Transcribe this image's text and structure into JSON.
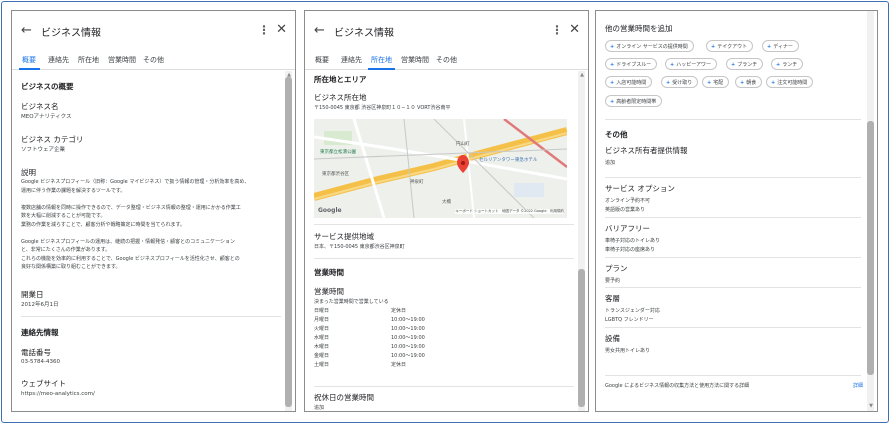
{
  "header": {
    "title": "ビジネス情報",
    "back_icon": "arrow-back-icon",
    "more_icon": "more-vert-icon",
    "close_icon": "close-icon"
  },
  "tabs": [
    "概要",
    "連絡先",
    "所在地",
    "営業時間",
    "その他"
  ],
  "panel1": {
    "overview_title": "ビジネスの概要",
    "name_label": "ビジネス名",
    "name_value": "MEOアナリティクス",
    "category_label": "ビジネス カテゴリ",
    "category_value": "ソフトウェア企業",
    "desc_label": "説明",
    "desc_lines": [
      "Google ビジネスプロフィール（旧称：Google マイビジネス）で扱う情報の管理・分析効率を高め、",
      "運用に伴う作業の課題を解決するツールです。",
      "",
      "複数店舗の情報を同時に操作できるので、データ整理・ビジネス情報の整理・運用にかかる作業工",
      "数を大幅に削減することが可能です。",
      "業務の作業を減らすことで、顧客分析や戦略策定に時間を当てられます。",
      "",
      "Google ビジネスプロフィールの運用は、継続の把握・情報発信・顧客とのコミュニケーション",
      "と、非常にたくさんの作業があります。",
      "これらの機能を効率的に利用することで、Google ビジネスプロフィールを活性化させ、顧客との",
      "良好な関係構築に取り組むことができます。"
    ],
    "opening_label": "開業日",
    "opening_value": "2012年6月1日",
    "contact_title": "連絡先情報",
    "phone_label": "電話番号",
    "phone_value": "03-5784-4360",
    "website_label": "ウェブサイト",
    "website_value": "https://meo-analytics.com/"
  },
  "panel2": {
    "location_title": "所在地とエリア",
    "address_label": "ビジネス所在地",
    "address_value": "〒150-0045 東京都 渋谷区神泉町１０−１０ VORT渋谷南平",
    "map": {
      "labels": [
        "東京都立松濤公園",
        "円山町",
        "セルリアンタワー東急ホテル",
        "東京都渋谷区",
        "神泉町",
        "大橋"
      ],
      "footer": "キーボード ショートカット　地図データ ©2022 Google　利用規約",
      "logo": "Google"
    },
    "service_area_label": "サービス提供地域",
    "service_area_value": "日本、〒150-0045 東京都渋谷区神泉町",
    "hours_title": "営業時間",
    "hours_label": "営業時間",
    "hours_note": "決まった営業時間で営業している",
    "hours": [
      {
        "day": "日曜日",
        "time": "定休日"
      },
      {
        "day": "月曜日",
        "time": "10:00～19:00"
      },
      {
        "day": "火曜日",
        "time": "10:00～19:00"
      },
      {
        "day": "水曜日",
        "time": "10:00～19:00"
      },
      {
        "day": "木曜日",
        "time": "10:00～19:00"
      },
      {
        "day": "金曜日",
        "time": "10:00～19:00"
      },
      {
        "day": "土曜日",
        "time": "定休日"
      }
    ],
    "holiday_label": "祝休日の営業時間",
    "holiday_value": "追加"
  },
  "panel3": {
    "add_hours_title": "他の営業時間を追加",
    "chips": [
      "オンライン サービスの提供時間",
      "テイクアウト",
      "ディナー",
      "ドライブスルー",
      "ハッピーアワー",
      "ブランチ",
      "ランチ",
      "入店可能時間",
      "受け取り",
      "宅配",
      "朝食",
      "注文可能時間",
      "高齢者限定時間帯"
    ],
    "other_title": "その他",
    "attrs": [
      {
        "label": "ビジネス所有者提供情報",
        "values": [
          "追加"
        ]
      },
      {
        "label": "サービス オプション",
        "values": [
          "オンライン予約不可",
          "英語版の営業あり"
        ]
      },
      {
        "label": "バリアフリー",
        "values": [
          "車椅子対応のトイレあり",
          "車椅子対応の座席あり"
        ]
      },
      {
        "label": "プラン",
        "values": [
          "要予約"
        ]
      },
      {
        "label": "客層",
        "values": [
          "トランスジェンダー対応",
          "LGBTQ フレンドリー"
        ]
      },
      {
        "label": "設備",
        "values": [
          "男女共用トイレあり"
        ]
      }
    ],
    "footer_text": "Google によるビジネス情報の収集方法と使用方法に関する詳細",
    "footer_link": "詳細"
  },
  "colors": {
    "accent": "#1a73e8",
    "frame": "#3d6fb5"
  }
}
